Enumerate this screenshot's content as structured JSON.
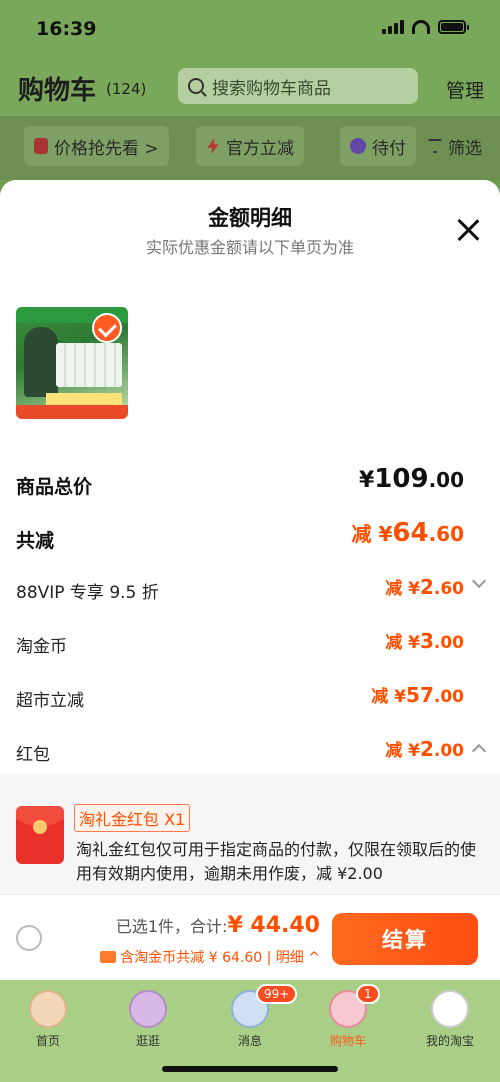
{
  "status_bar": {
    "time": "16:39"
  },
  "header": {
    "title": "购物车",
    "count": "(124)",
    "search_placeholder": "搜索购物车商品",
    "manage": "管理"
  },
  "filters": {
    "price_watch": "价格抢先看 >",
    "official_discount": "官方立减",
    "pending": "待付",
    "filter": "筛选"
  },
  "sheet": {
    "title": "金额明细",
    "subtitle": "实际优惠金额请以下单页为准",
    "rows": {
      "total_label": "商品总价",
      "total_currency": "¥",
      "total_int": "109",
      "total_dec": ".00",
      "saved_label": "共减",
      "saved_prefix": "减 ¥",
      "saved_int": "64",
      "saved_dec": ".60",
      "vip_label": "88VIP 专享 9.5 折",
      "vip_prefix": "减 ¥",
      "vip_int": "2",
      "vip_dec": ".60",
      "coin_label": "淘金币",
      "coin_prefix": "减 ¥",
      "coin_int": "3",
      "coin_dec": ".00",
      "market_label": "超市立减",
      "market_prefix": "减 ¥",
      "market_int": "57",
      "market_dec": ".00",
      "redpacket_label": "红包",
      "redpacket_prefix": "减 ¥",
      "redpacket_int": "2",
      "redpacket_dec": ".00"
    },
    "redpacket": {
      "tag": "淘礼金红包 X1",
      "desc": "淘礼金红包仅可用于指定商品的付款，仅限在领取后的使用有效期内使用，逾期未用作废，减 ¥2.00"
    }
  },
  "checkout": {
    "selected": "已选1件，",
    "total_label": "合计:",
    "total_amount": "¥ 44.40",
    "discount": "含淘金币共减 ¥ 64.60",
    "detail": "| 明细 ^",
    "button": "结算"
  },
  "tabbar": {
    "home": "首页",
    "browse": "逛逛",
    "messages": "消息",
    "messages_badge": "99+",
    "cart": "购物车",
    "cart_badge": "1",
    "mine": "我的淘宝"
  },
  "colors": {
    "accent": "#ff5000",
    "header_bg": "#7aa85a"
  }
}
